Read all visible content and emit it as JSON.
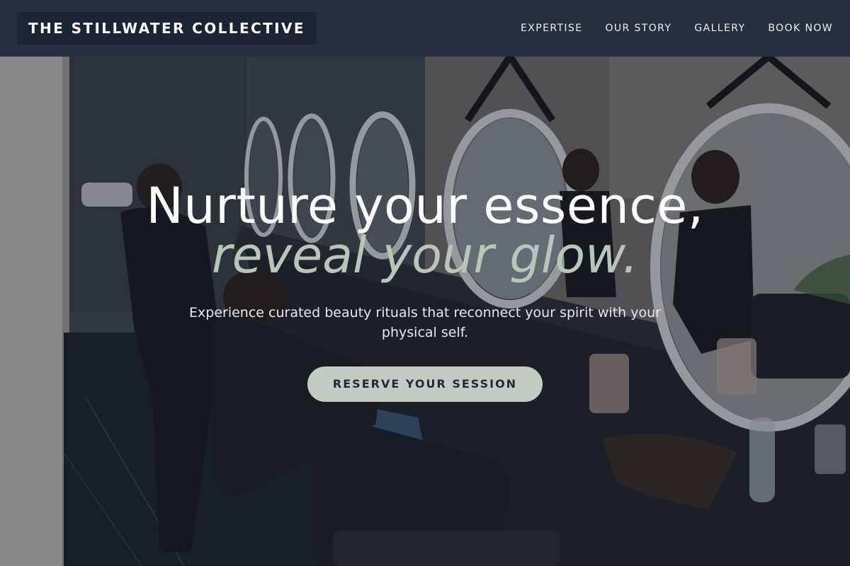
{
  "header": {
    "brand": "THE STILLWATER COLLECTIVE",
    "nav": [
      {
        "label": "EXPERTISE"
      },
      {
        "label": "OUR STORY"
      },
      {
        "label": "GALLERY"
      },
      {
        "label": "BOOK NOW"
      }
    ]
  },
  "hero": {
    "headline": "Nurture your essence,",
    "headline_accent": "reveal your glow.",
    "subtext": "Experience curated beauty rituals that reconnect your spirit with your physical self.",
    "cta_label": "RESERVE YOUR SESSION",
    "background_image": "salon-interior-photo"
  },
  "colors": {
    "header_bg": "#263040",
    "accent_sage": "#b9c4bb",
    "cta_bg": "#c2ccc2",
    "cta_text": "#1e2a3b"
  }
}
